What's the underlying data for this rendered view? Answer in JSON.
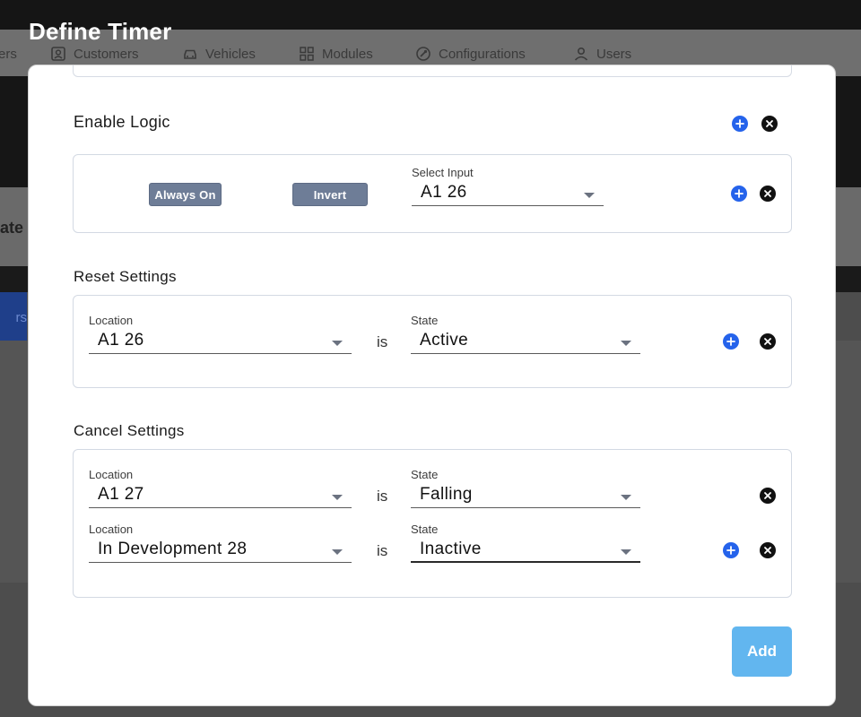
{
  "dialog": {
    "title": "Define Timer"
  },
  "background_nav": {
    "items": [
      {
        "label": "ers",
        "icon": "cut-off-item"
      },
      {
        "label": "Customers",
        "icon": "customers-icon"
      },
      {
        "label": "Vehicles",
        "icon": "car-icon"
      },
      {
        "label": "Modules",
        "icon": "grid-icon"
      },
      {
        "label": "Configurations",
        "icon": "config-icon"
      },
      {
        "label": "Users",
        "icon": "user-icon"
      }
    ],
    "side_text": "ate",
    "side_button": "rs"
  },
  "enable_logic": {
    "title": "Enable Logic",
    "always_on_label": "Always On",
    "invert_label": "Invert",
    "select_input_label": "Select Input",
    "select_input_value": "A1 26"
  },
  "reset_settings": {
    "title": "Reset Settings",
    "location_label": "Location",
    "location_value": "A1 26",
    "is_label": "is",
    "state_label": "State",
    "state_value": "Active"
  },
  "cancel_settings": {
    "title": "Cancel Settings",
    "rows": [
      {
        "location_label": "Location",
        "location_value": "A1 27",
        "is_label": "is",
        "state_label": "State",
        "state_value": "Falling"
      },
      {
        "location_label": "Location",
        "location_value": "In Development 28",
        "is_label": "is",
        "state_label": "State",
        "state_value": "Inactive"
      }
    ]
  },
  "footer": {
    "add_label": "Add"
  },
  "colors": {
    "accent_blue": "#2563eb",
    "add_button": "#62b6ef",
    "chip": "#6e7d97"
  }
}
